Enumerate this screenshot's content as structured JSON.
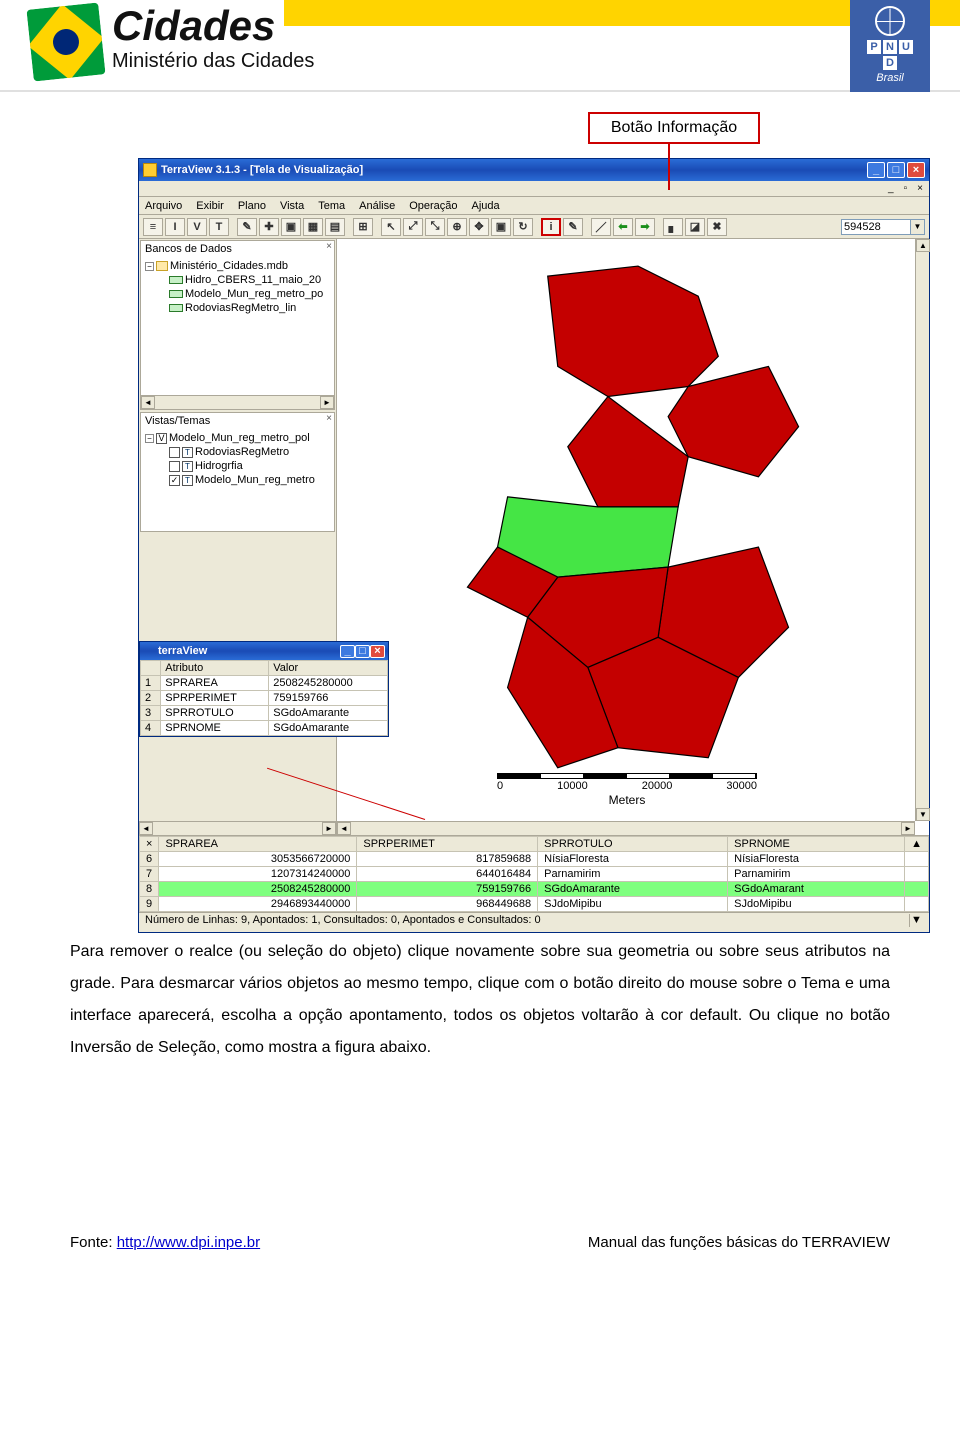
{
  "header": {
    "brand_primary": "Cidades",
    "brand_secondary": "Ministério das Cidades",
    "pnud_letters": [
      "P",
      "N",
      "U",
      "D"
    ],
    "pnud_country": "Brasil"
  },
  "annotation": {
    "label": "Botão Informação"
  },
  "win": {
    "title": "TerraView 3.1.3 - [Tela de Visualização]",
    "inner_controls": {
      "restore": "↗",
      "close": "×"
    },
    "menu": [
      "Arquivo",
      "Exibir",
      "Plano",
      "Vista",
      "Tema",
      "Análise",
      "Operação",
      "Ajuda"
    ],
    "menu_u": [
      "A",
      "E",
      "P",
      "V",
      "T",
      "A",
      "O",
      "A"
    ],
    "scale_value": "594528",
    "tree_db_title": "Bancos de Dados",
    "db_root": "Ministério_Cidades.mdb",
    "db_layers": [
      "Hidro_CBERS_11_maio_20",
      "Modelo_Mun_reg_metro_po",
      "RodoviasRegMetro_lin"
    ],
    "tree_vt_title": "Vistas/Temas",
    "vt_root": "Modelo_Mun_reg_metro_pol",
    "vt_root_checked": "✓",
    "vt_items": [
      {
        "checked": "",
        "label": "RodoviasRegMetro"
      },
      {
        "checked": "",
        "label": "Hidrogrfia"
      },
      {
        "checked": "✓",
        "label": "Modelo_Mun_reg_metro"
      }
    ],
    "attr_win_title": "terraView",
    "attr_headers": [
      "",
      "Atributo",
      "Valor"
    ],
    "attr_rows": [
      {
        "n": "1",
        "a": "SPRAREA",
        "v": "2508245280000"
      },
      {
        "n": "2",
        "a": "SPRPERIMET",
        "v": "759159766"
      },
      {
        "n": "3",
        "a": "SPRROTULO",
        "v": "SGdoAmarante"
      },
      {
        "n": "4",
        "a": "SPRNOME",
        "v": "SGdoAmarante"
      }
    ],
    "scalebar_ticks": [
      "0",
      "10000",
      "20000",
      "30000"
    ],
    "scalebar_unit": "Meters",
    "grid_headers": [
      "",
      "SPRAREA",
      "SPRPERIMET",
      "SPRROTULO",
      "SPRNOME"
    ],
    "grid_rows": [
      {
        "n": "6",
        "area": "3053566720000",
        "perim": "817859688",
        "rot": "NísiaFloresta",
        "nome": "NísiaFloresta",
        "hl": false
      },
      {
        "n": "7",
        "area": "1207314240000",
        "perim": "644016484",
        "rot": "Parnamirim",
        "nome": "Parnamirim",
        "hl": false
      },
      {
        "n": "8",
        "area": "2508245280000",
        "perim": "759159766",
        "rot": "SGdoAmarante",
        "nome": "SGdoAmarant",
        "hl": true
      },
      {
        "n": "9",
        "area": "2946893440000",
        "perim": "968449688",
        "rot": "SJdoMipibu",
        "nome": "SJdoMipibu",
        "hl": false
      }
    ],
    "status": "Número de Linhas: 9, Apontados: 1, Consultados: 0, Apontados e Consultados: 0"
  },
  "doc": {
    "p1a": "Para remover o realce (ou seleção do objeto) clique novamente sobre sua geometria ou sobre seus atributos na grade. Para desmarcar vários objetos ao mesmo tempo, clique com o botão direito do mouse sobre o Tema e uma interface aparecerá, escolha a opção apontamento, todos os objetos voltarão à cor default. Ou clique no botão Inversão de Seleção, como mostra a figura abaixo."
  },
  "footer": {
    "left_label": "Fonte: ",
    "left_url": "http://www.dpi.inpe.br",
    "right": "Manual das funções básicas do TERRAVIEW"
  }
}
